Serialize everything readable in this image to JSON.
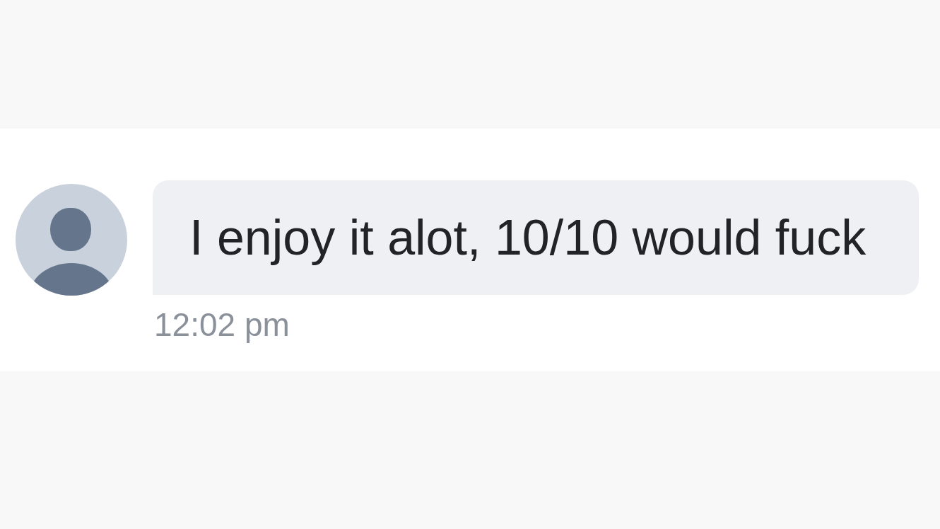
{
  "message": {
    "text": "I enjoy it alot, 10/10 would fuck",
    "time": "12:02 pm"
  }
}
